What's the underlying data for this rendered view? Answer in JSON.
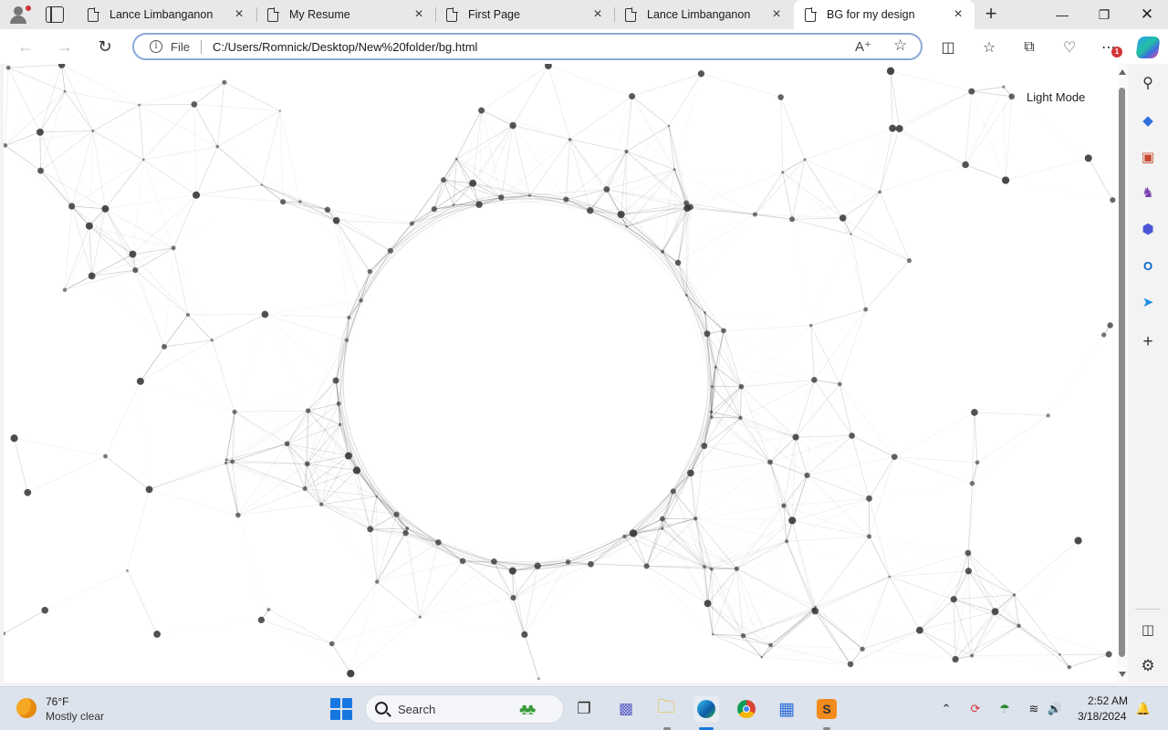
{
  "browser": {
    "tabs": [
      {
        "title": "Lance Limbanganon",
        "active": false
      },
      {
        "title": "My Resume",
        "active": false
      },
      {
        "title": "First Page",
        "active": false
      },
      {
        "title": "Lance Limbanganon",
        "active": false
      },
      {
        "title": "BG for my design",
        "active": true
      }
    ],
    "omnibox": {
      "scheme_label": "File",
      "url": "C:/Users/Romnick/Desktop/New%20folder/bg.html"
    },
    "notification_badge": "1",
    "accent": "#1677e0"
  },
  "page": {
    "mode_button_label": "Light Mode",
    "background_color": "#ffffff",
    "line_color": "#000000"
  },
  "sidebar": {
    "icons": [
      "search-icon",
      "tag-icon",
      "briefcase-icon",
      "chess-icon",
      "office-icon",
      "outlook-icon",
      "send-icon",
      "plus-icon",
      "sidebar-panel-icon",
      "settings-icon"
    ]
  },
  "taskbar": {
    "weather": {
      "temperature": "76°F",
      "condition": "Mostly clear"
    },
    "search_placeholder": "Search",
    "apps": [
      "task-view-icon",
      "teams-icon",
      "file-explorer-icon",
      "edge-icon",
      "chrome-icon",
      "store-icon",
      "sublime-icon"
    ],
    "tray": [
      "chevron-up-icon",
      "sync-icon",
      "shield-icon",
      "wifi-icon",
      "volume-icon"
    ],
    "clock": {
      "time": "2:52 AM",
      "date": "3/18/2024"
    }
  }
}
